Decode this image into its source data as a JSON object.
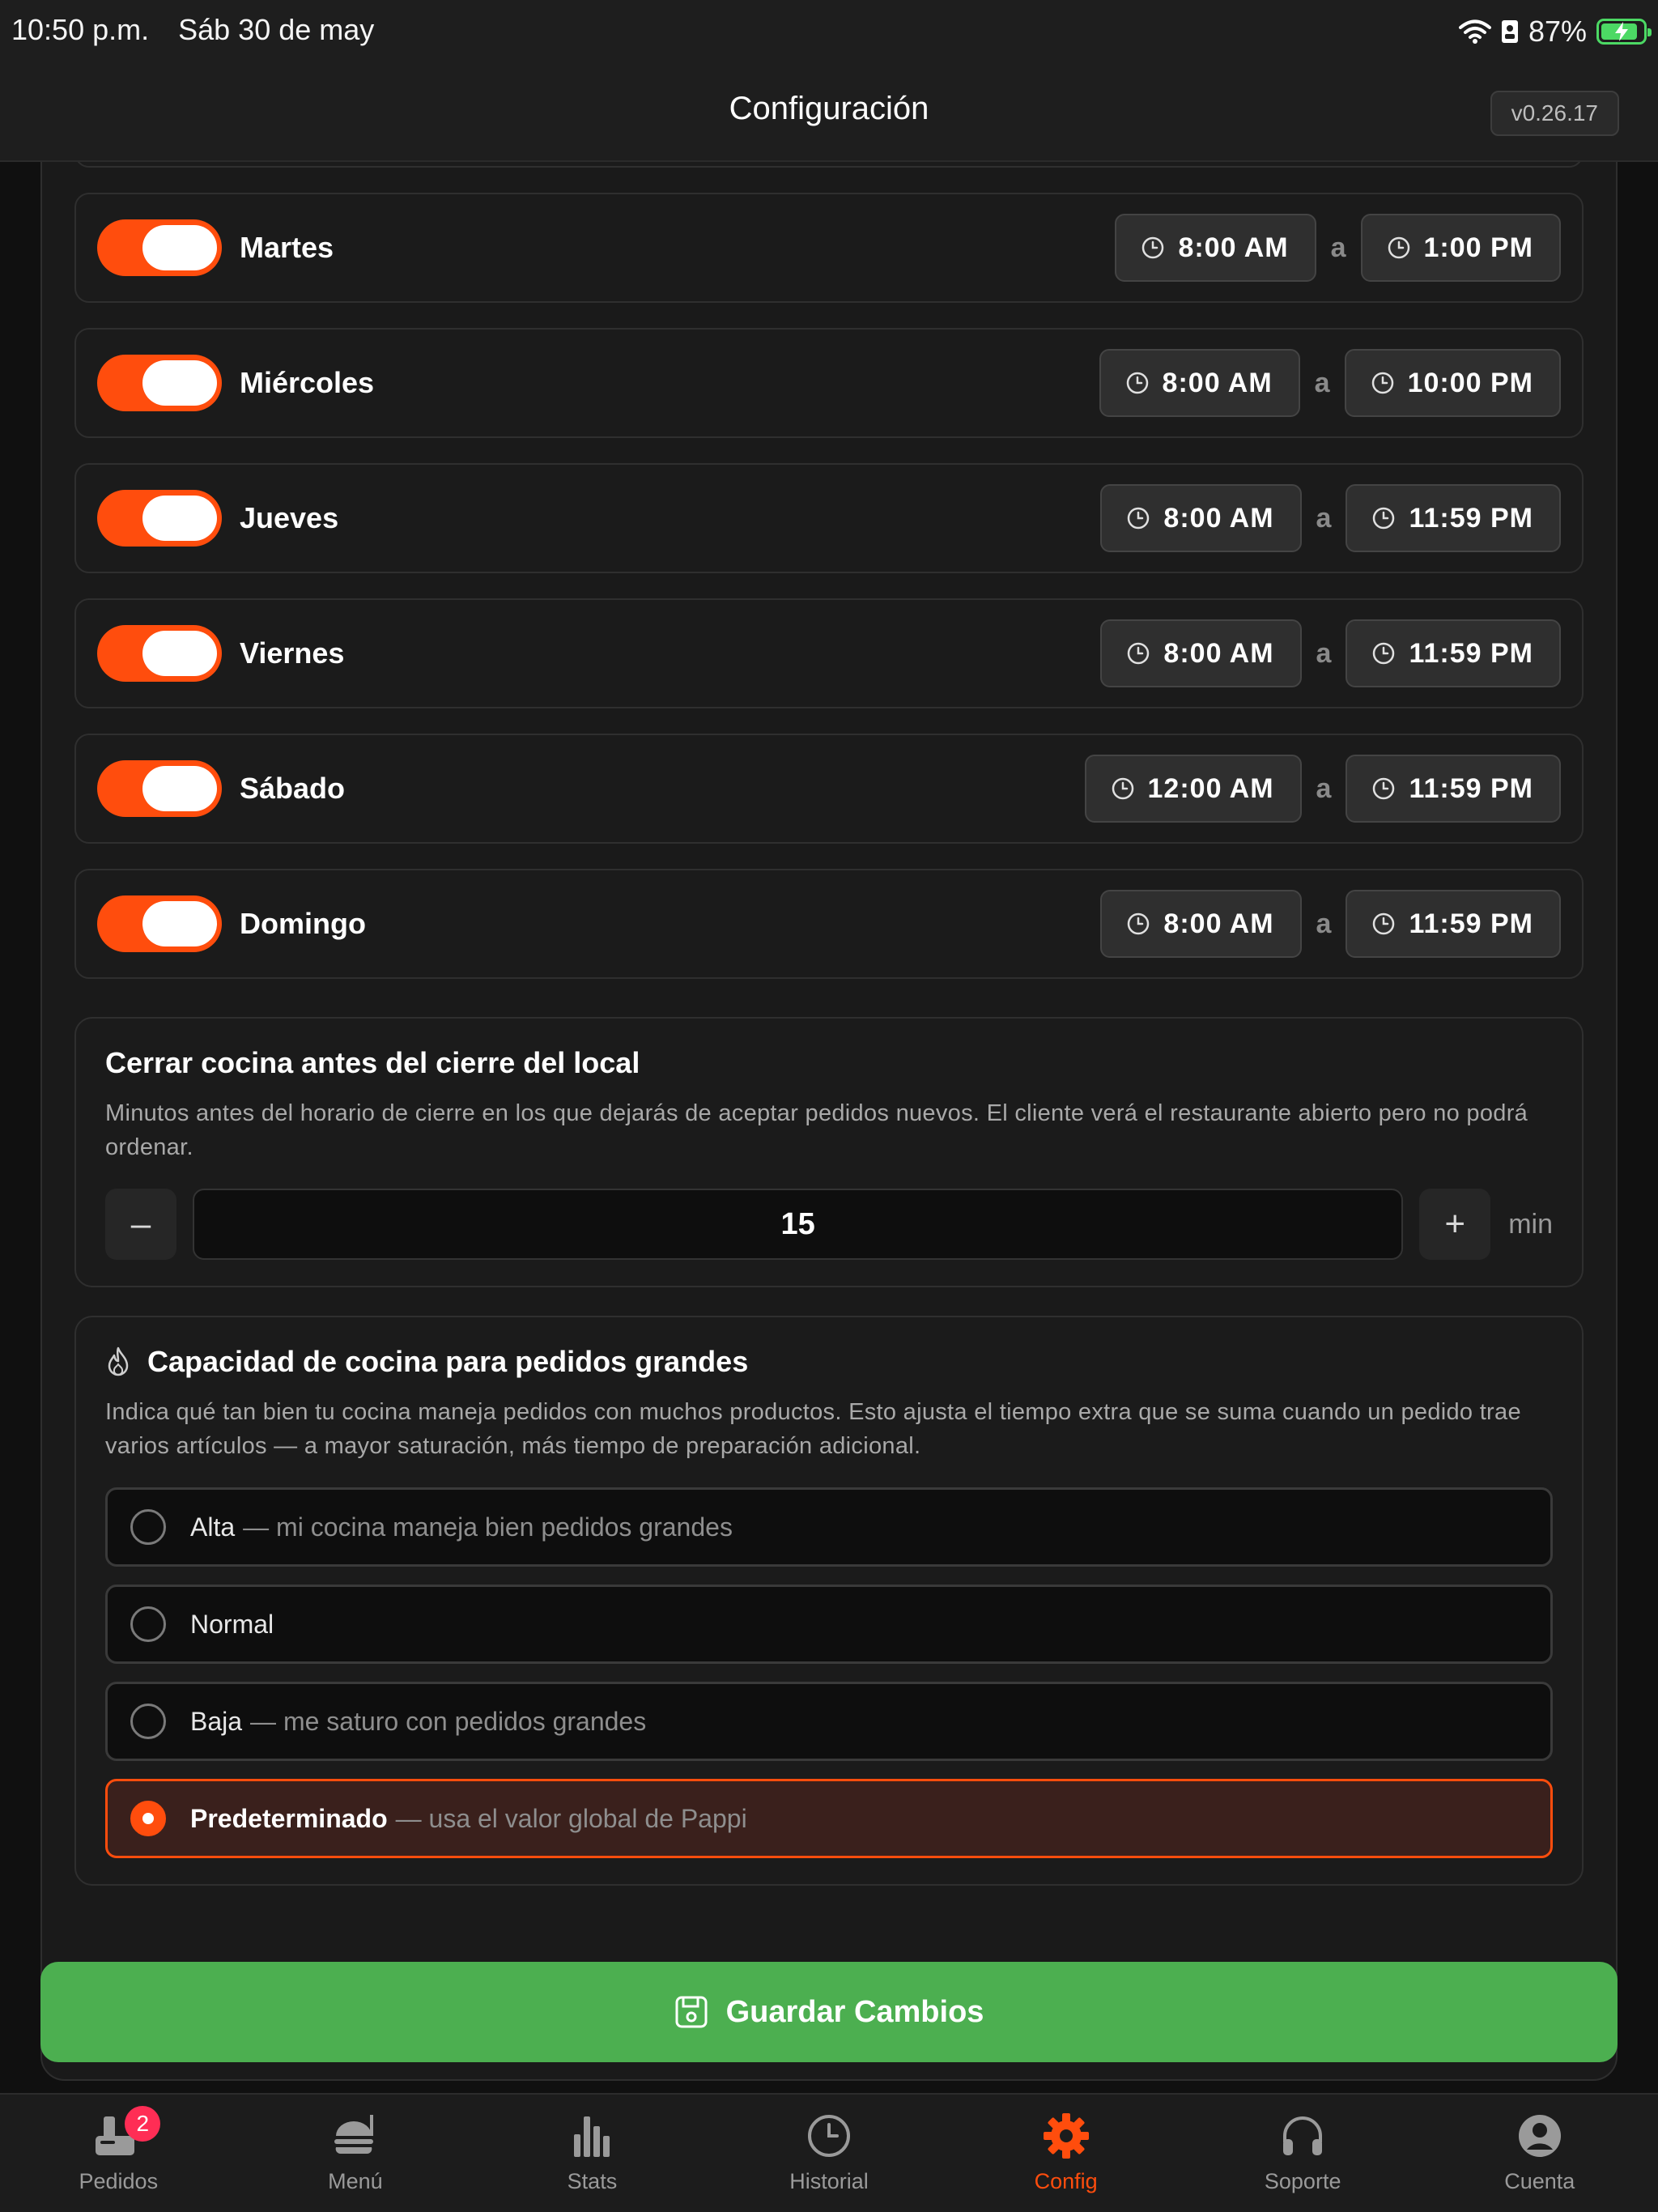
{
  "status_bar": {
    "time": "10:50 p.m.",
    "date": "Sáb 30 de may",
    "battery": "87%",
    "battery_level": 0.87
  },
  "header": {
    "title": "Configuración",
    "version": "v0.26.17"
  },
  "schedule": {
    "separator": "a",
    "days": [
      {
        "name": "Martes",
        "enabled": true,
        "open": "8:00 AM",
        "close": "1:00 PM"
      },
      {
        "name": "Miércoles",
        "enabled": true,
        "open": "8:00 AM",
        "close": "10:00 PM"
      },
      {
        "name": "Jueves",
        "enabled": true,
        "open": "8:00 AM",
        "close": "11:59 PM"
      },
      {
        "name": "Viernes",
        "enabled": true,
        "open": "8:00 AM",
        "close": "11:59 PM"
      },
      {
        "name": "Sábado",
        "enabled": true,
        "open": "12:00 AM",
        "close": "11:59 PM"
      },
      {
        "name": "Domingo",
        "enabled": true,
        "open": "8:00 AM",
        "close": "11:59 PM"
      }
    ]
  },
  "kitchen_close": {
    "title": "Cerrar cocina antes del cierre del local",
    "description": "Minutos antes del horario de cierre en los que dejarás de aceptar pedidos nuevos. El cliente verá el restaurante abierto pero no podrá ordenar.",
    "value": "15",
    "decrement": "–",
    "increment": "+",
    "unit": "min"
  },
  "capacity": {
    "title": "Capacidad de cocina para pedidos grandes",
    "description": "Indica qué tan bien tu cocina maneja pedidos con muchos productos. Esto ajusta el tiempo extra que se suma cuando un pedido trae varios artículos — a mayor saturación, más tiempo de preparación adicional.",
    "options": [
      {
        "label": "Alta",
        "desc": "— mi cocina maneja bien pedidos grandes",
        "selected": false
      },
      {
        "label": "Normal",
        "desc": "",
        "selected": false
      },
      {
        "label": "Baja",
        "desc": "— me saturo con pedidos grandes",
        "selected": false
      },
      {
        "label": "Predeterminado",
        "desc": "— usa el valor global de Pappi",
        "selected": true
      }
    ]
  },
  "save_button": "Guardar Cambios",
  "tabs": [
    {
      "label": "Pedidos",
      "icon": "orders-icon",
      "badge": "2",
      "active": false
    },
    {
      "label": "Menú",
      "icon": "burger-icon",
      "active": false
    },
    {
      "label": "Stats",
      "icon": "bar-chart-icon",
      "active": false
    },
    {
      "label": "Historial",
      "icon": "clock-icon",
      "active": false
    },
    {
      "label": "Config",
      "icon": "gear-icon",
      "active": true
    },
    {
      "label": "Soporte",
      "icon": "headphones-icon",
      "active": false
    },
    {
      "label": "Cuenta",
      "icon": "account-icon",
      "active": false
    }
  ],
  "colors": {
    "accent": "#ff4d0d",
    "save": "#4caf50",
    "badge": "#ff2d55",
    "background": "#101010"
  }
}
